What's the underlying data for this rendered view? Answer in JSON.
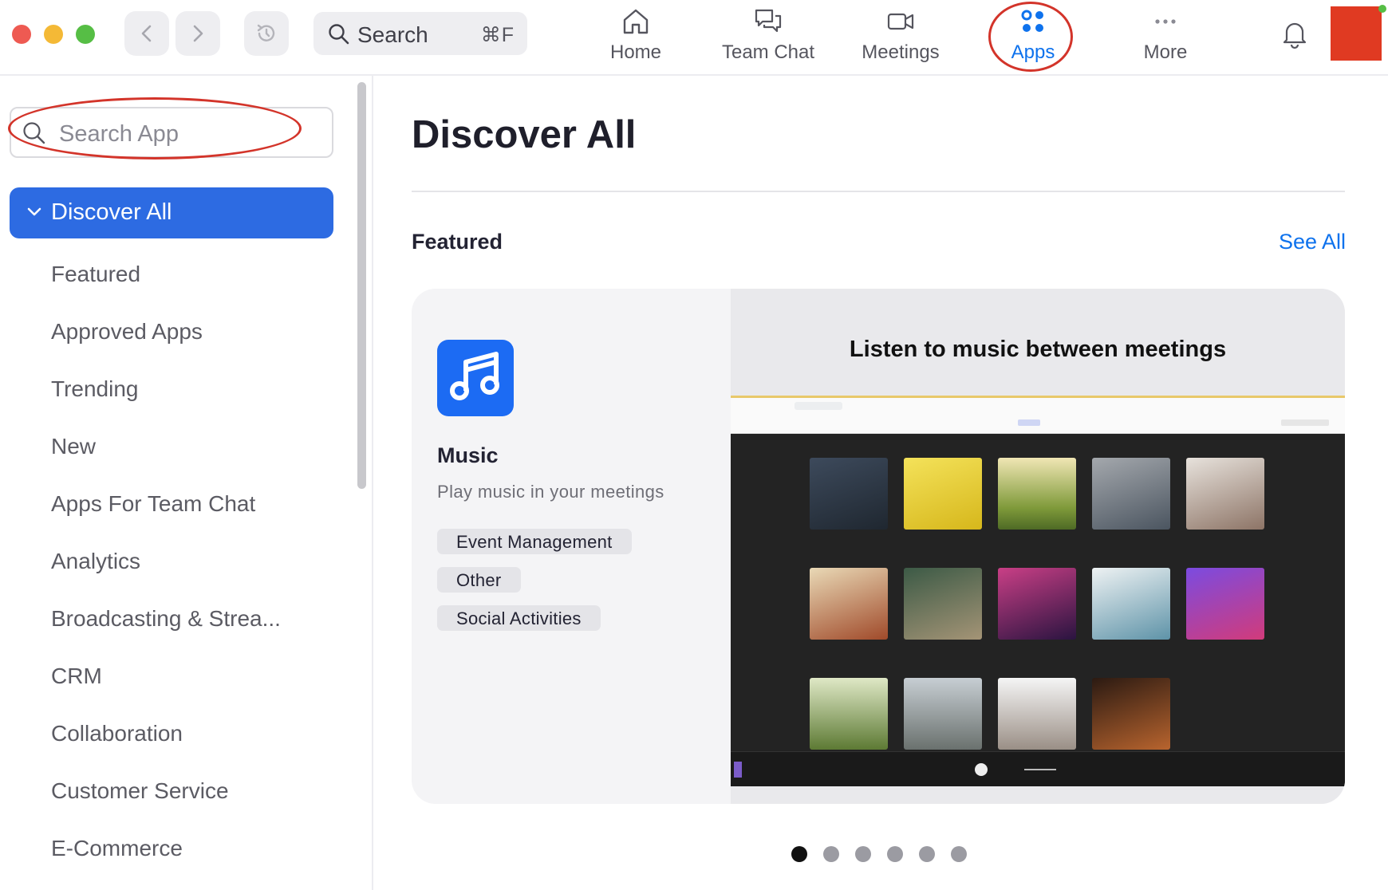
{
  "toolbar": {
    "search_label": "Search",
    "search_shortcut": "⌘F",
    "tabs": [
      {
        "label": "Home",
        "icon": "home-icon"
      },
      {
        "label": "Team Chat",
        "icon": "chat-icon"
      },
      {
        "label": "Meetings",
        "icon": "video-icon"
      },
      {
        "label": "Apps",
        "icon": "apps-icon",
        "active": true
      },
      {
        "label": "More",
        "icon": "more-icon"
      }
    ]
  },
  "sidebar": {
    "search_placeholder": "Search App",
    "selected_category": "Discover All",
    "categories": [
      "Featured",
      "Approved Apps",
      "Trending",
      "New",
      "Apps For Team Chat",
      "Analytics",
      "Broadcasting & Strea...",
      "CRM",
      "Collaboration",
      "Customer Service",
      "E-Commerce"
    ]
  },
  "main": {
    "title": "Discover All",
    "section_title": "Featured",
    "see_all_label": "See All",
    "featured_card": {
      "app_name": "Music",
      "description": "Play music in your meetings",
      "tags": [
        "Event Management",
        "Other",
        "Social Activities"
      ],
      "banner_title": "Listen to music between meetings"
    },
    "pager": {
      "count": 6,
      "active_index": 0
    }
  },
  "colors": {
    "accent": "#0e72ed",
    "selected_category_bg": "#2d6be2",
    "annotation_circle": "#d3342a"
  }
}
